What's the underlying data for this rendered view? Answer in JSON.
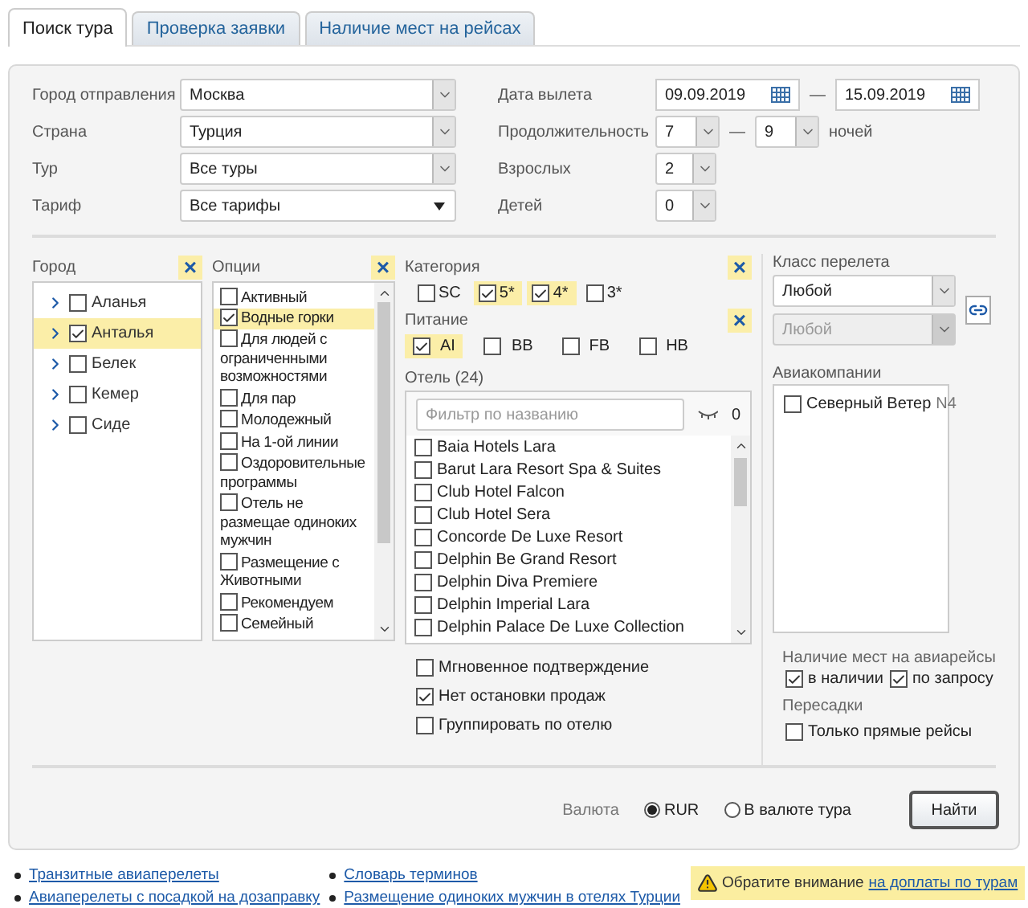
{
  "tabs": [
    {
      "label": "Поиск тура",
      "selected": true
    },
    {
      "label": "Проверка заявки",
      "selected": false
    },
    {
      "label": "Наличие мест на рейсах",
      "selected": false
    }
  ],
  "left_fields": [
    {
      "label": "Город отправления",
      "value": "Москва",
      "kind": "combo"
    },
    {
      "label": "Страна",
      "value": "Турция",
      "kind": "combo"
    },
    {
      "label": "Тур",
      "value": "Все туры",
      "kind": "combo"
    },
    {
      "label": "Тариф",
      "value": "Все тарифы",
      "kind": "dropdown"
    }
  ],
  "departure": {
    "label": "Дата вылета",
    "from": "09.09.2019",
    "dash": "—",
    "to": "15.09.2019"
  },
  "duration": {
    "label": "Продолжительность",
    "from": "7",
    "dash": "—",
    "to": "9",
    "unit": "ночей"
  },
  "adults": {
    "label": "Взрослых",
    "value": "2"
  },
  "children": {
    "label": "Детей",
    "value": "0"
  },
  "city": {
    "title": "Город",
    "clear": "×",
    "items": [
      {
        "name": "Аланья",
        "checked": false
      },
      {
        "name": "Анталья",
        "checked": true
      },
      {
        "name": "Белек",
        "checked": false
      },
      {
        "name": "Кемер",
        "checked": false
      },
      {
        "name": "Сиде",
        "checked": false
      }
    ]
  },
  "options": {
    "title": "Опции",
    "clear": "×",
    "items": [
      {
        "label": "Активный",
        "checked": false
      },
      {
        "label": "Водные горки",
        "checked": true
      },
      {
        "label": "Для людей с ограниченными возможностями",
        "checked": false
      },
      {
        "label": "Для пар",
        "checked": false
      },
      {
        "label": "Молодежный",
        "checked": false
      },
      {
        "label": "На 1-ой линии",
        "checked": false
      },
      {
        "label": "Оздоровительные программы",
        "checked": false
      },
      {
        "label": "Отель не размещае одиноких мужчин",
        "checked": false
      },
      {
        "label": "Размещение с Животными",
        "checked": false
      },
      {
        "label": "Рекомендуем",
        "checked": false
      },
      {
        "label": "Семейный",
        "checked": false
      }
    ]
  },
  "category": {
    "title": "Категория",
    "clear": "×",
    "items": [
      {
        "label": "SC",
        "checked": false
      },
      {
        "label": "5*",
        "checked": true
      },
      {
        "label": "4*",
        "checked": true
      },
      {
        "label": "3*",
        "checked": false
      }
    ]
  },
  "meal": {
    "title": "Питание",
    "clear": "×",
    "items": [
      {
        "label": "AI",
        "checked": true
      },
      {
        "label": "BB",
        "checked": false
      },
      {
        "label": "FB",
        "checked": false
      },
      {
        "label": "HB",
        "checked": false
      }
    ]
  },
  "hotels": {
    "title": "Отель (24)",
    "placeholder": "Фильтр по названию",
    "count": "0",
    "items": [
      {
        "name": "Baia Hotels Lara",
        "checked": false
      },
      {
        "name": "Barut Lara Resort Spa & Suites",
        "checked": false
      },
      {
        "name": "Club Hotel Falcon",
        "checked": false
      },
      {
        "name": "Club Hotel Sera",
        "checked": false
      },
      {
        "name": "Concorde De Luxe Resort",
        "checked": false
      },
      {
        "name": "Delphin Be Grand Resort",
        "checked": false
      },
      {
        "name": "Delphin Diva Premiere",
        "checked": false
      },
      {
        "name": "Delphin Imperial Lara",
        "checked": false
      },
      {
        "name": "Delphin Palace De Luxe Collection",
        "checked": false
      }
    ]
  },
  "flags": [
    {
      "label": "Мгновенное подтверждение",
      "checked": false
    },
    {
      "label": "Нет остановки продаж",
      "checked": true
    },
    {
      "label": "Группировать по отелю",
      "checked": false
    }
  ],
  "flight_class": {
    "title": "Класс перелета",
    "value": "Любой",
    "second_value": "Любой",
    "second_disabled": true
  },
  "airlines": {
    "title": "Авиакомпании",
    "items": [
      {
        "name": "Северный Ветер",
        "code": "N4",
        "checked": false
      }
    ]
  },
  "availability": {
    "title": "Наличие мест на авиарейсы",
    "items": [
      {
        "label": "в наличии",
        "checked": true
      },
      {
        "label": "по запросу",
        "checked": true
      }
    ]
  },
  "transfers": {
    "title": "Пересадки",
    "items": [
      {
        "label": "Только прямые рейсы",
        "checked": false
      }
    ]
  },
  "currency": {
    "label": "Валюта",
    "options": [
      {
        "label": "RUR",
        "selected": true
      },
      {
        "label": "В валюте тура",
        "selected": false
      }
    ]
  },
  "search_button": "Найти",
  "links": [
    [
      "Транзитные авиаперелеты",
      "Авиаперелеты с посадкой на дозаправку"
    ],
    [
      "Словарь терминов",
      "Размещение одиноких мужчин в отелях Турции"
    ]
  ],
  "notice": {
    "text": "Обратите внимание",
    "link": "на доплаты по турам"
  }
}
